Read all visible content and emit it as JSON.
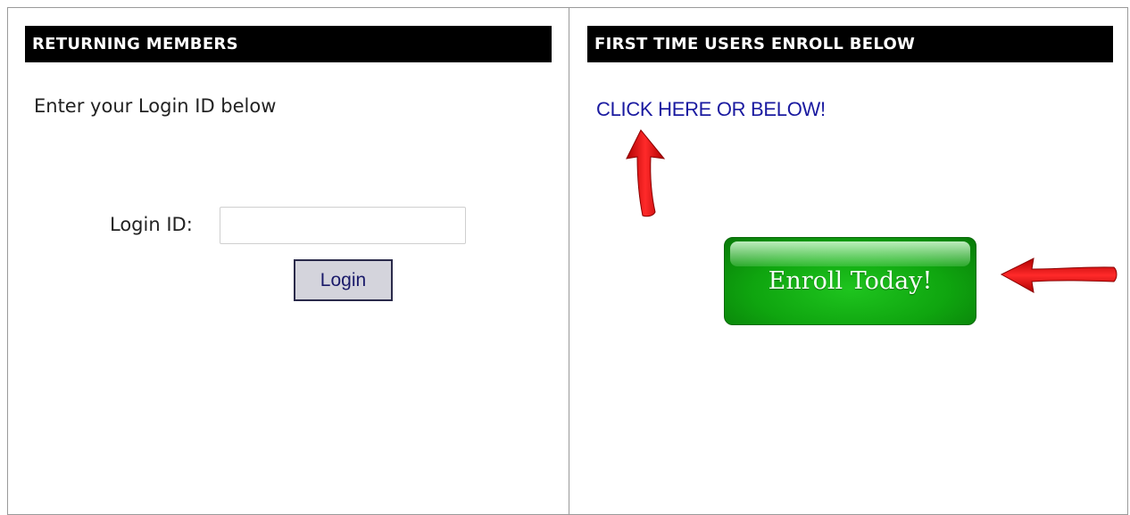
{
  "left_panel": {
    "header": "RETURNING MEMBERS",
    "intro": "Enter your Login ID below",
    "login_label": "Login ID:",
    "login_value": "",
    "login_placeholder": "",
    "login_button": "Login"
  },
  "right_panel": {
    "header": "FIRST TIME USERS ENROLL BELOW",
    "link_text": "CLICK HERE OR BELOW!",
    "enroll_button": "Enroll Today!"
  },
  "icons": {
    "up_arrow": "red-arrow-up-icon",
    "left_arrow": "red-arrow-left-icon"
  },
  "colors": {
    "header_bg": "#000000",
    "link": "#1a1aa0",
    "enroll_green": "#0fa50f",
    "arrow_red": "#e01010"
  }
}
